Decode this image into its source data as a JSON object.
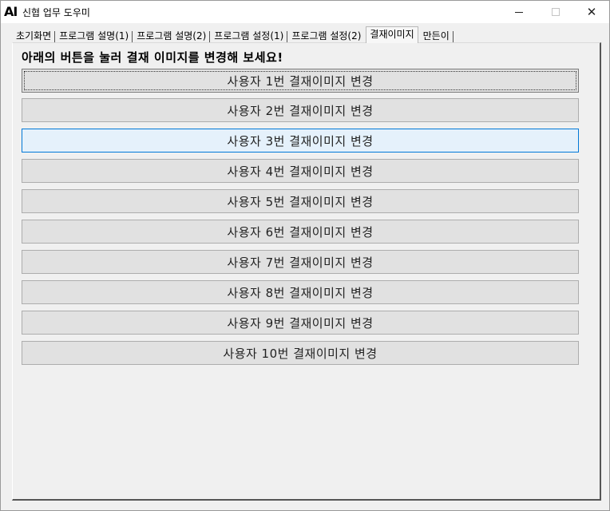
{
  "window": {
    "logo": "AI",
    "title": "신협 업무 도우미",
    "controls": {
      "minimize": "—",
      "maximize": "□",
      "close": "✕"
    }
  },
  "tabs": [
    {
      "label": "초기화면",
      "active": false
    },
    {
      "label": "프로그램 설명(1)",
      "active": false
    },
    {
      "label": "프로그램 설명(2)",
      "active": false
    },
    {
      "label": "프로그램 설정(1)",
      "active": false
    },
    {
      "label": "프로그램 설정(2)",
      "active": false
    },
    {
      "label": "결재이미지",
      "active": true
    },
    {
      "label": "만든이",
      "active": false
    }
  ],
  "heading": "아래의 버튼을 눌러 결재 이미지를 변경해 보세요!",
  "buttons": [
    {
      "label": "사용자 1번 결재이미지 변경"
    },
    {
      "label": "사용자 2번 결재이미지 변경"
    },
    {
      "label": "사용자 3번 결재이미지 변경"
    },
    {
      "label": "사용자 4번 결재이미지 변경"
    },
    {
      "label": "사용자 5번 결재이미지 변경"
    },
    {
      "label": "사용자 6번 결재이미지 변경"
    },
    {
      "label": "사용자 7번 결재이미지 변경"
    },
    {
      "label": "사용자 8번 결재이미지 변경"
    },
    {
      "label": "사용자 9번 결재이미지 변경"
    },
    {
      "label": "사용자 10번 결재이미지 변경"
    }
  ],
  "colors": {
    "button_bg": "#e1e1e1",
    "button_hover_bg": "#e5f1fb",
    "button_hover_border": "#0078d7"
  }
}
